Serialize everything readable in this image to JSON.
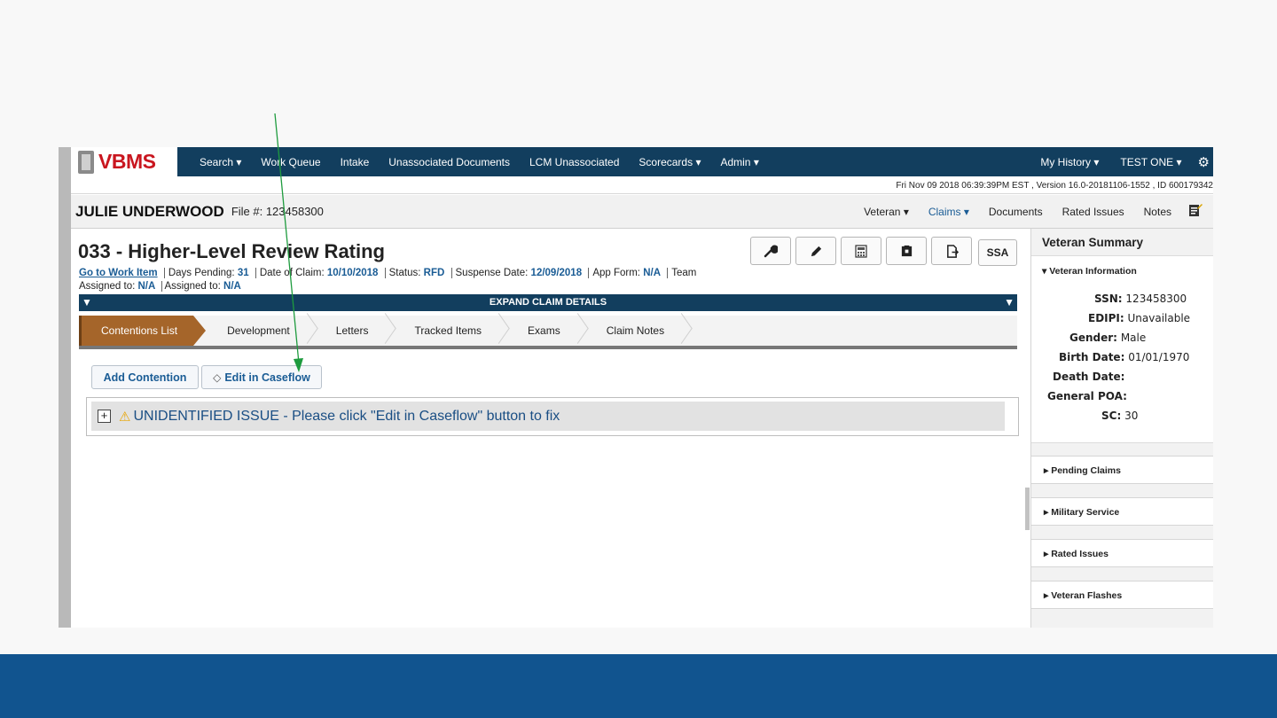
{
  "app": {
    "logo": "VBMS",
    "nav": {
      "search": "Search",
      "work_queue": "Work Queue",
      "intake": "Intake",
      "unassociated_documents": "Unassociated Documents",
      "lcm_unassociated": "LCM Unassociated",
      "scorecards": "Scorecards",
      "admin": "Admin",
      "my_history": "My History",
      "user": "TEST ONE",
      "caret": "▾"
    },
    "info_strip": "Fri Nov 09 2018 06:39:39PM EST , Version 16.0-20181106-1552 , ID 600179342"
  },
  "veteran_bar": {
    "name": "JULIE UNDERWOOD",
    "file_label": "File #: 123458300",
    "tabs": {
      "veteran": "Veteran",
      "claims": "Claims",
      "documents": "Documents",
      "rated_issues": "Rated Issues",
      "notes": "Notes"
    }
  },
  "claim": {
    "title": "033 - Higher-Level Review Rating",
    "go_to_work_item": "Go to Work Item",
    "days_pending_label": "Days Pending:",
    "days_pending": "31",
    "date_of_claim_label": "Date of Claim:",
    "date_of_claim": "10/10/2018",
    "status_label": "Status:",
    "status": "RFD",
    "suspense_label": "Suspense Date:",
    "suspense_date": "12/09/2018",
    "app_form_label": "App Form:",
    "app_form": "N/A",
    "team_label": "Team",
    "assigned_to_label_1": "Assigned to:",
    "assigned_to_1": "N/A",
    "assigned_to_label_2": "Assigned to:",
    "assigned_to_2": "N/A",
    "expand_details": "EXPAND CLAIM DETAILS",
    "ssa_label": "SSA"
  },
  "steps": [
    "Contentions List",
    "Development",
    "Letters",
    "Tracked Items",
    "Exams",
    "Claim Notes"
  ],
  "buttons": {
    "add_contention": "Add Contention",
    "edit_in_caseflow": "Edit in Caseflow"
  },
  "issue": {
    "toggle": "+",
    "text": "UNIDENTIFIED ISSUE - Please click \"Edit in Caseflow\" button to fix"
  },
  "summary": {
    "title": "Veteran Summary",
    "info_section": "Veteran Information",
    "fields": {
      "ssn_label": "SSN:",
      "ssn": "123458300",
      "edipi_label": "EDIPI:",
      "edipi": "Unavailable",
      "gender_label": "Gender:",
      "gender": "Male",
      "birth_label": "Birth Date:",
      "birth": "01/01/1970",
      "death_label": "Death Date:",
      "poa_label": "General POA:",
      "sc_label": "SC:",
      "sc": "30"
    },
    "sections": [
      "Pending Claims",
      "Military Service",
      "Rated Issues",
      "Veteran Flashes"
    ]
  },
  "colors": {
    "nav_bg": "#123e5e",
    "active_step": "#a5652a",
    "link_blue": "#1a5c95",
    "brand_red": "#c9161f",
    "annotation_arrow": "#1e9b3e",
    "footer_band": "#11548f"
  }
}
